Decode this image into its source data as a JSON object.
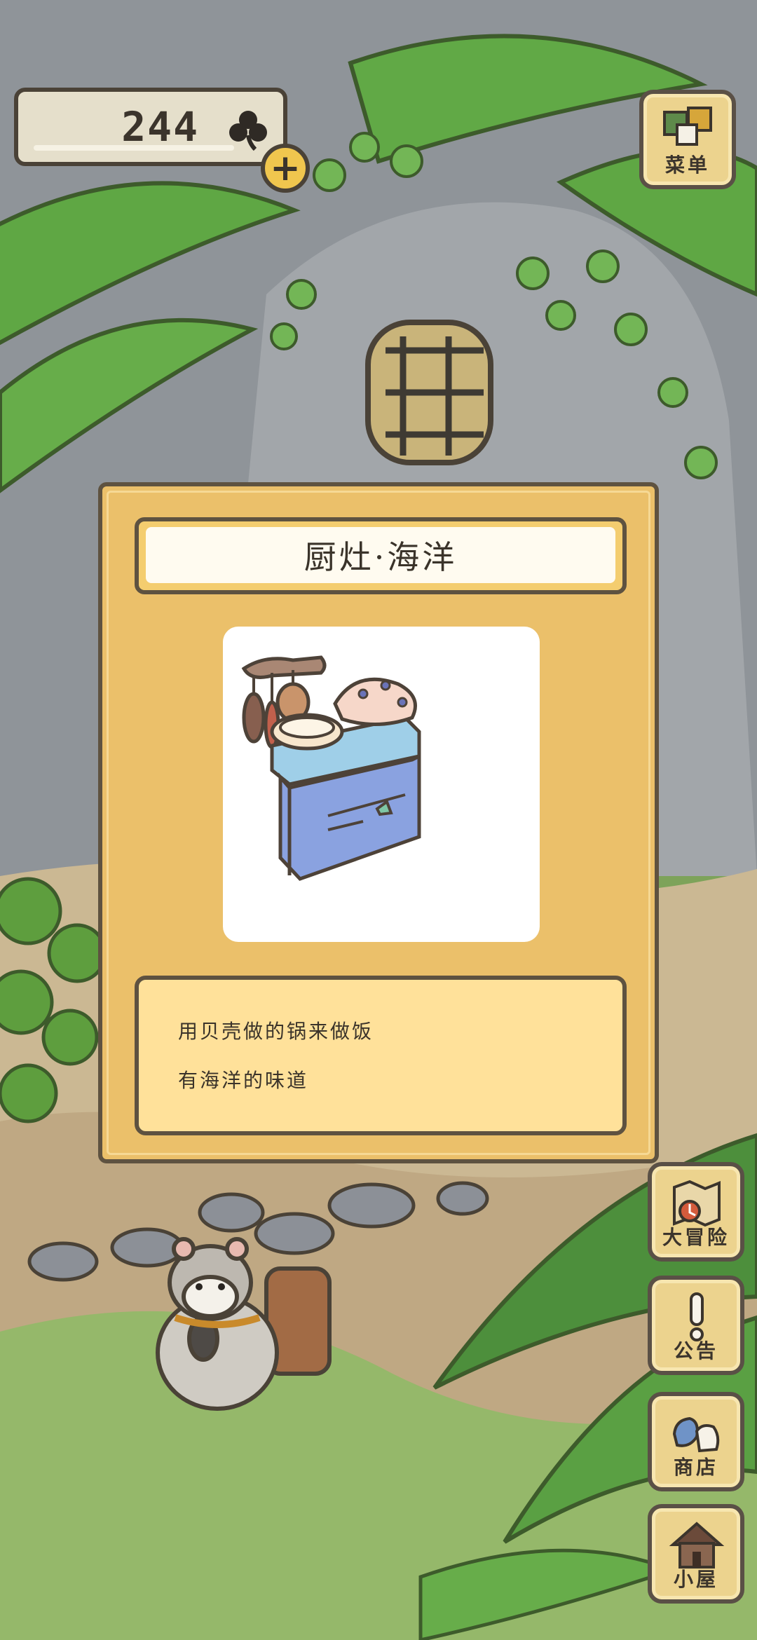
{
  "counter": {
    "value": "244",
    "icon": "clover-icon",
    "add_icon": "plus-icon"
  },
  "side_menu": {
    "menu": {
      "label": "菜单",
      "icon": "menu-cards-icon"
    },
    "adventure": {
      "label": "大冒险",
      "icon": "map-compass-icon"
    },
    "notice": {
      "label": "公告",
      "icon": "exclamation-icon"
    },
    "shop": {
      "label": "商店",
      "icon": "shop-bags-icon"
    },
    "house": {
      "label": "小屋",
      "icon": "house-icon"
    }
  },
  "dialog": {
    "title": "厨灶·海洋",
    "image_icon": "ocean-stove-icon",
    "description": [
      "用贝壳做的锅来做饭",
      "有海洋的味道"
    ]
  },
  "colors": {
    "dialog_bg": "#ebc06a",
    "desc_bg": "#ffe19a",
    "button_bg": "#ecd38e",
    "outline": "#5e5240"
  }
}
